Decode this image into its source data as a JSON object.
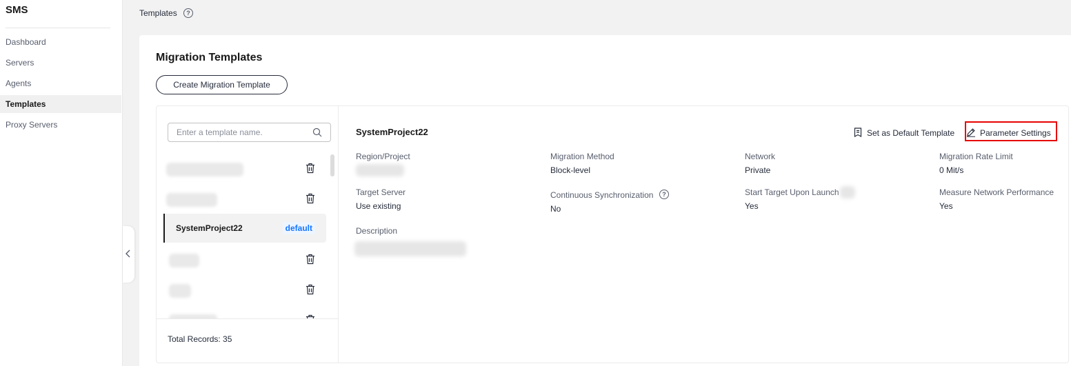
{
  "app": {
    "title": "SMS"
  },
  "sidebar": {
    "items": [
      {
        "label": "Dashboard"
      },
      {
        "label": "Servers"
      },
      {
        "label": "Agents"
      },
      {
        "label": "Templates"
      },
      {
        "label": "Proxy Servers"
      }
    ]
  },
  "header": {
    "breadcrumb": "Templates",
    "help": "?"
  },
  "main": {
    "title": "Migration Templates",
    "create_button": "Create Migration Template"
  },
  "template_list": {
    "search_placeholder": "Enter a template name.",
    "selected": {
      "name": "SystemProject22",
      "tag": "default"
    },
    "total": "Total Records: 35"
  },
  "details": {
    "name": "SystemProject22",
    "set_default_label": "Set as Default Template",
    "parameter_settings_label": "Parameter Settings",
    "fields": {
      "region_project": {
        "label": "Region/Project"
      },
      "migration_method": {
        "label": "Migration Method",
        "value": "Block-level"
      },
      "network": {
        "label": "Network",
        "value": "Private"
      },
      "migration_rate_limit": {
        "label": "Migration Rate Limit",
        "value": "0 Mit/s"
      },
      "target_server": {
        "label": "Target Server",
        "value": "Use existing"
      },
      "continuous_sync": {
        "label": "Continuous Synchronization",
        "value": "No"
      },
      "start_target": {
        "label": "Start Target Upon Launch",
        "value": "Yes"
      },
      "measure_network": {
        "label": "Measure Network Performance",
        "value": "Yes"
      },
      "description": {
        "label": "Description"
      }
    }
  },
  "colors": {
    "accent": "#1476ff",
    "highlight_border": "#e60000",
    "primary_text": "#191919"
  },
  "icons": [
    "search-icon",
    "trash-icon",
    "help-icon",
    "set-default-icon",
    "edit-icon",
    "chevron-left-icon"
  ]
}
